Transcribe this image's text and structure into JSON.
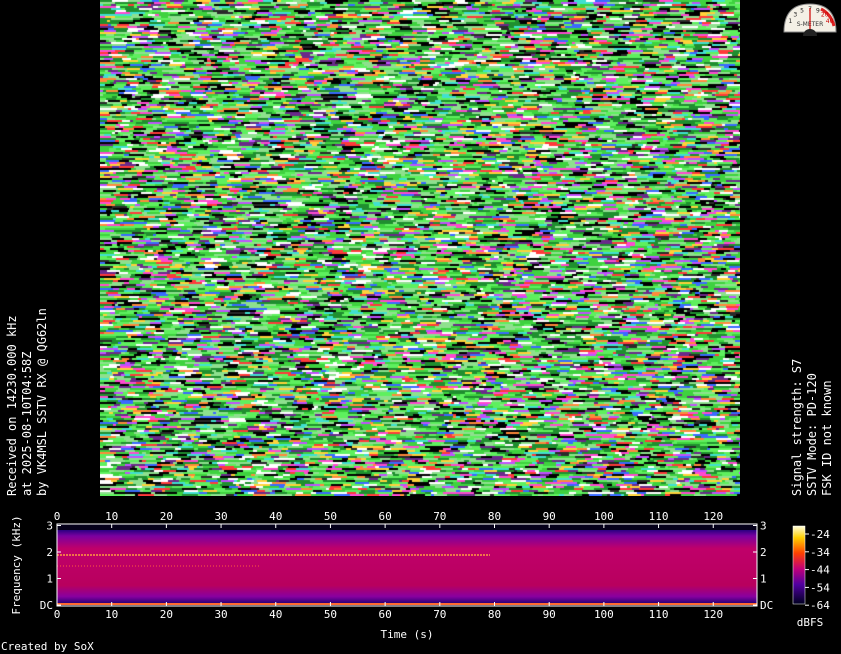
{
  "rx_info": {
    "line1": "Received on 14230.000 kHz",
    "line2": "at 2025-08-10T04:58Z",
    "line3": "by VK4MSL SSTV RX @ QG62ln"
  },
  "signal_info": {
    "line1": "Signal strength: S7",
    "line2": "SSTV Mode: PD-120",
    "line3": "FSK ID not known"
  },
  "s_meter": {
    "scale": [
      "1",
      "3",
      "5",
      "7",
      "9",
      "20",
      "40"
    ],
    "unit_label": "S-METER",
    "level_s": 7
  },
  "spectrogram": {
    "x_ticks": [
      "0",
      "10",
      "20",
      "30",
      "40",
      "50",
      "60",
      "70",
      "80",
      "90",
      "100",
      "110",
      "120"
    ],
    "x_axis_label": "Time (s)",
    "y_ticks": [
      "DC",
      "1",
      "2",
      "3"
    ],
    "y_axis_label": "Frequency (kHz)",
    "colorbar_ticks": [
      "-24",
      "-34",
      "-44",
      "-54",
      "-64"
    ],
    "colorbar_unit": "dBFS"
  },
  "footer": {
    "credit": "Created by SoX"
  },
  "colors": {
    "noise_base": "#3fd23f",
    "spectro_bg": "#b0006a",
    "text": "#ffffff"
  }
}
